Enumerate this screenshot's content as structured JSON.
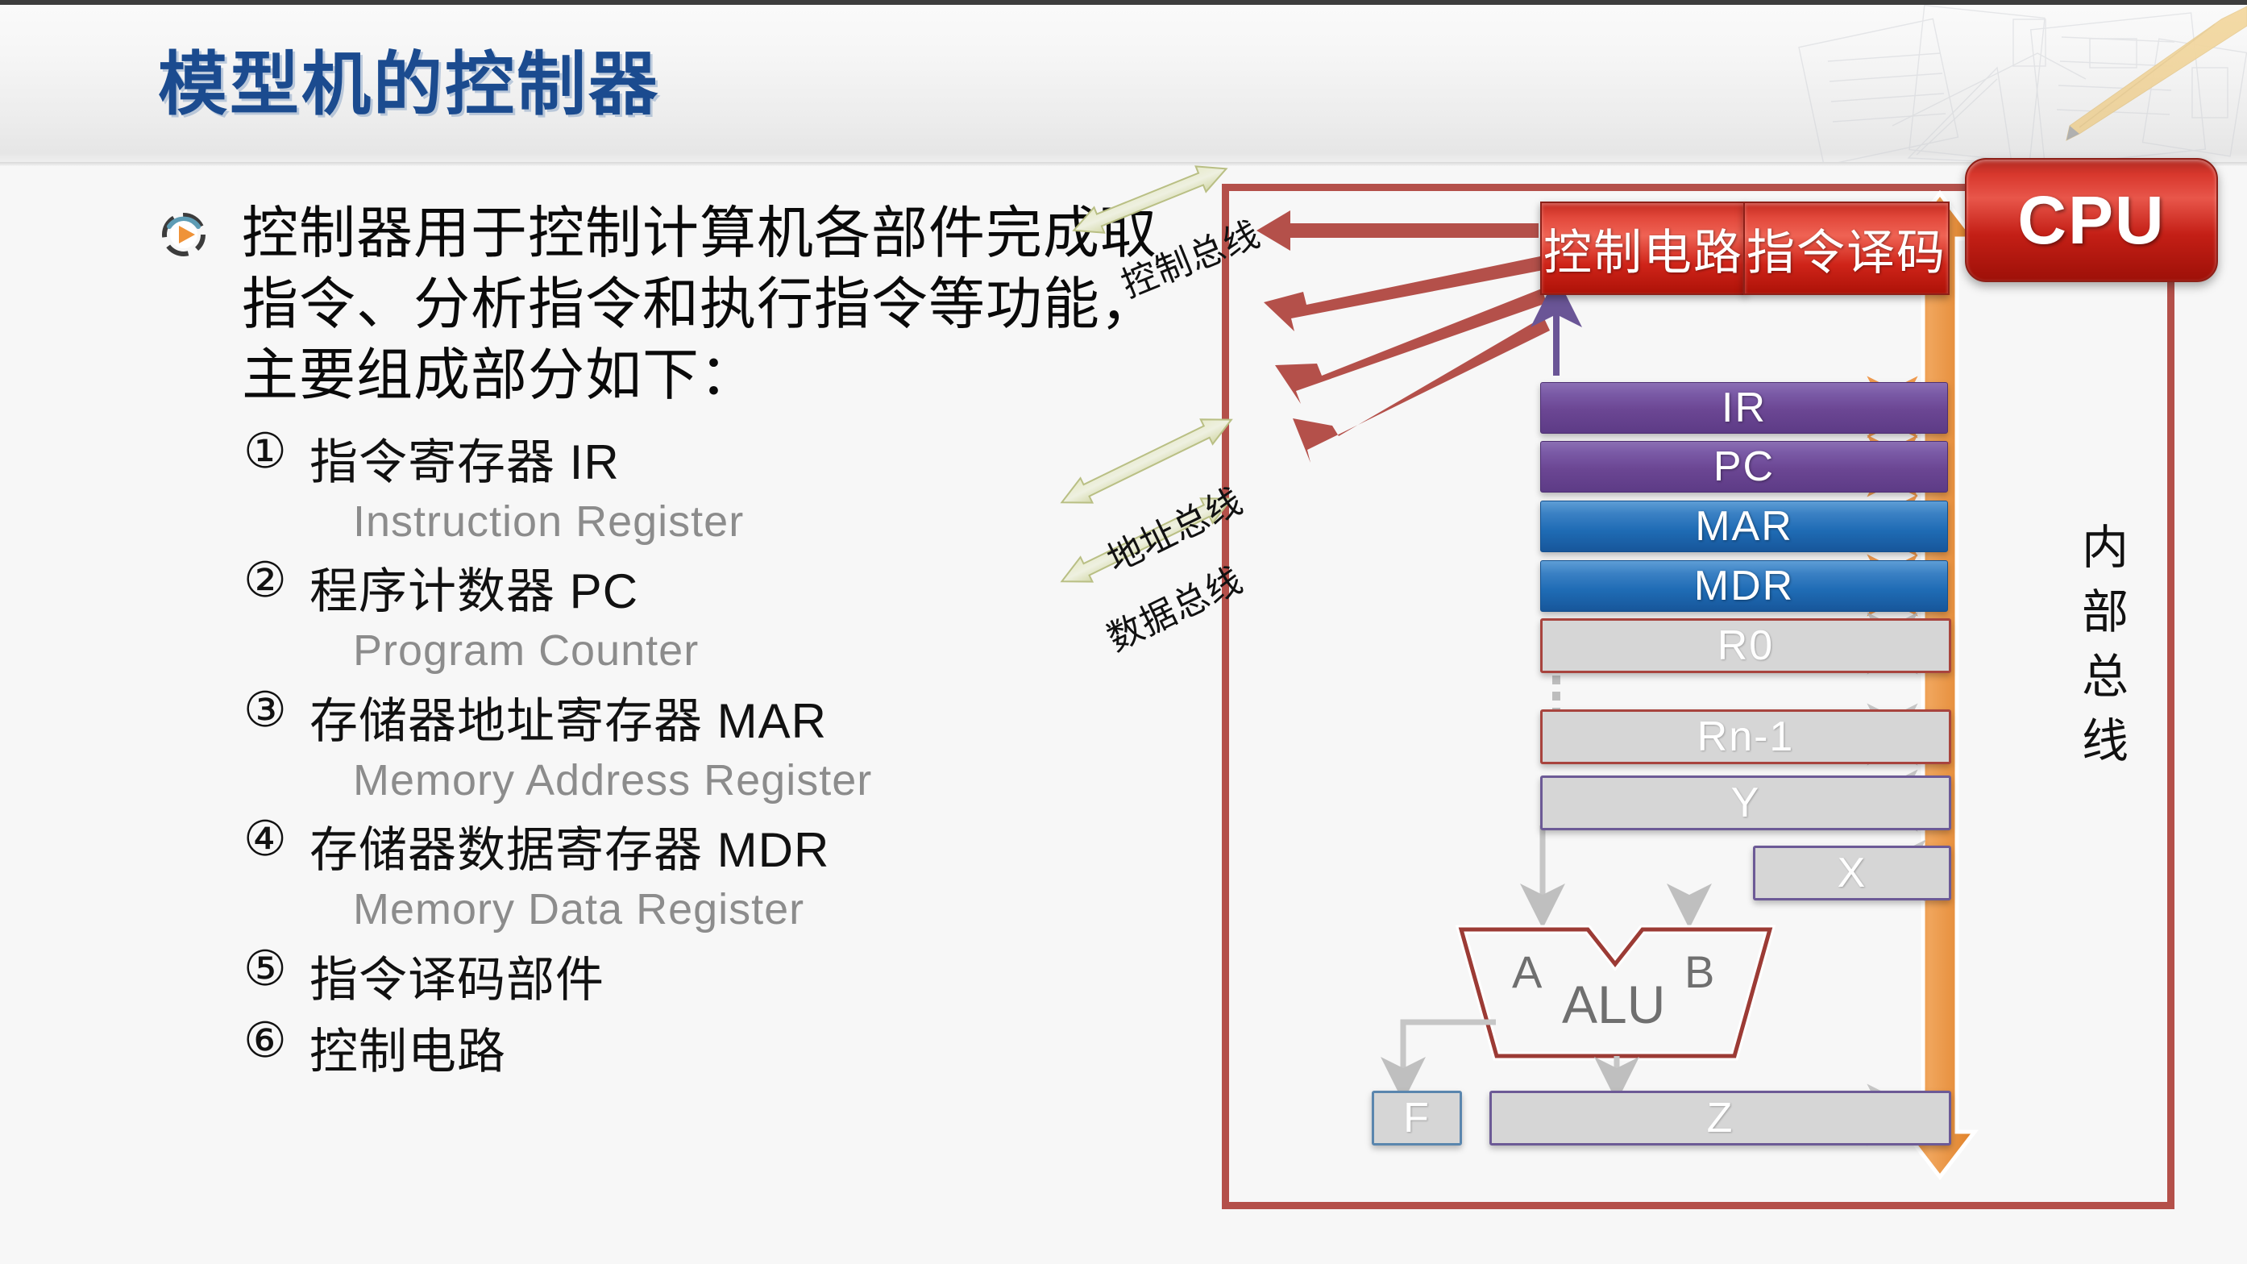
{
  "header": {
    "title": "模型机的控制器",
    "decoration": "blueprint-pencil-image"
  },
  "content": {
    "bullet_icon": "play-circle-icon",
    "lead_paragraph": "控制器用于控制计算机各部件完成取指令、分析指令和执行指令等功能，主要组成部分如下：",
    "items": [
      {
        "index": "①",
        "zh": "指令寄存器 IR",
        "en": "Instruction Register"
      },
      {
        "index": "②",
        "zh": "程序计数器 PC",
        "en": "Program Counter"
      },
      {
        "index": "③",
        "zh": "存储器地址寄存器 MAR",
        "en": "Memory Address Register"
      },
      {
        "index": "④",
        "zh": "存储器数据寄存器 MDR",
        "en": "Memory Data Register"
      },
      {
        "index": "⑤",
        "zh": "指令译码部件",
        "en": ""
      },
      {
        "index": "⑥",
        "zh": "控制电路",
        "en": ""
      }
    ]
  },
  "diagram": {
    "cpu_badge": "CPU",
    "control_circuit": "控制电路",
    "instruction_decoder": "指令译码",
    "registers": [
      {
        "label": "IR",
        "style": "purple"
      },
      {
        "label": "PC",
        "style": "purple"
      },
      {
        "label": "MAR",
        "style": "blue"
      },
      {
        "label": "MDR",
        "style": "blue"
      },
      {
        "label": "R0",
        "style": "gray-red"
      },
      {
        "label": "Rn-1",
        "style": "gray-red"
      },
      {
        "label": "Y",
        "style": "gray-purple"
      },
      {
        "label": "X",
        "style": "gray-purple"
      },
      {
        "label": "F",
        "style": "gray-blue"
      },
      {
        "label": "Z",
        "style": "gray-purple"
      }
    ],
    "alu": {
      "name": "ALU",
      "input_a": "A",
      "input_b": "B"
    },
    "buses": {
      "control_bus": "控制总线",
      "address_bus": "地址总线",
      "data_bus": "数据总线",
      "internal_bus": "内部总线"
    },
    "ellipsis": "⋮"
  },
  "colors": {
    "title_blue": "#1b4b8f",
    "frame_red": "#b4504a",
    "cpu_red": "#c41f16",
    "register_purple": "#6b4693",
    "register_blue": "#1f6cb5",
    "internal_bus_orange": "#ec9a4d",
    "bus_arrow_olive": "#d9dcb4",
    "english_gray": "#8c8c8c"
  }
}
